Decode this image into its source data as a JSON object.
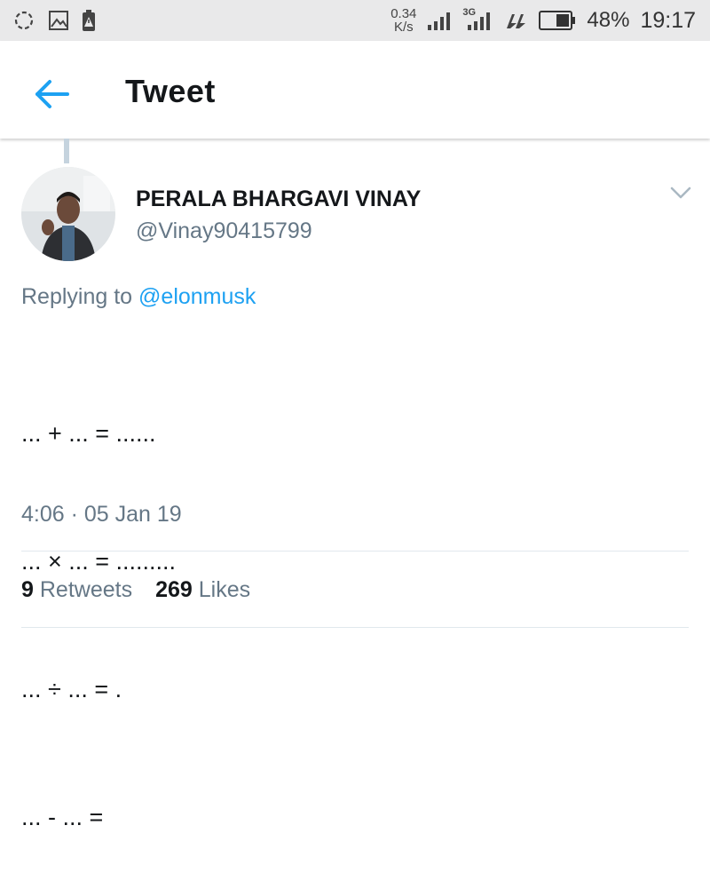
{
  "status_bar": {
    "left_icons": [
      "sync-icon",
      "image-icon",
      "battery-alert-icon"
    ],
    "speed_value": "0.34",
    "speed_unit": "K/s",
    "network_label": "3G",
    "battery_percent": "48%",
    "time": "19:17"
  },
  "header": {
    "title": "Tweet"
  },
  "tweet": {
    "author_name": "PERALA BHARGAVI VINAY",
    "author_handle": "@Vinay90415799",
    "replying_prefix": "Replying to",
    "replying_to": "@elonmusk",
    "lines": [
      "... + ... = ......",
      "... × ... = .........",
      "... ÷ ... = .",
      "... - ... ="
    ],
    "timestamp": "4:06 · 05 Jan 19",
    "retweets_count": "9",
    "retweets_label": "Retweets",
    "likes_count": "269",
    "likes_label": "Likes"
  },
  "colors": {
    "accent": "#1da1f2",
    "secondary_text": "#657786",
    "primary_text": "#14171a"
  }
}
